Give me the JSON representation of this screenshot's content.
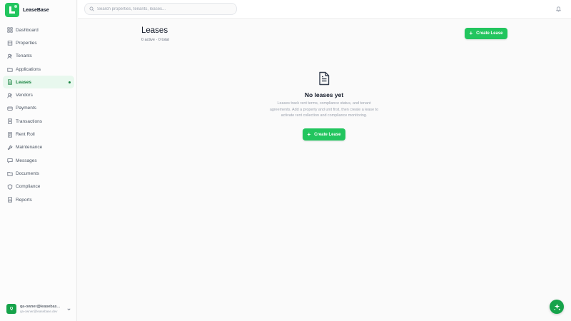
{
  "brand": {
    "name": "LeaseBase"
  },
  "search": {
    "placeholder": "Search properties, tenants, leases..."
  },
  "sidebar": {
    "items": [
      {
        "label": "Dashboard",
        "icon": "grid-icon"
      },
      {
        "label": "Properties",
        "icon": "building-icon"
      },
      {
        "label": "Tenants",
        "icon": "users-icon"
      },
      {
        "label": "Applications",
        "icon": "folder-icon"
      },
      {
        "label": "Leases",
        "icon": "file-icon",
        "active": true
      },
      {
        "label": "Vendors",
        "icon": "users-icon"
      },
      {
        "label": "Payments",
        "icon": "credit-card-icon"
      },
      {
        "label": "Transactions",
        "icon": "list-icon"
      },
      {
        "label": "Rent Roll",
        "icon": "document-icon"
      },
      {
        "label": "Maintenance",
        "icon": "wrench-icon"
      },
      {
        "label": "Messages",
        "icon": "message-icon"
      },
      {
        "label": "Documents",
        "icon": "folder-icon"
      },
      {
        "label": "Compliance",
        "icon": "shield-icon"
      },
      {
        "label": "Reports",
        "icon": "report-icon"
      }
    ]
  },
  "user": {
    "initial": "Q",
    "name": "qa-owner@leasebas...",
    "email": "qa-owner@leasebase.dev"
  },
  "main": {
    "title": "Leases",
    "subtitle": "0 active · 0 total",
    "create_label": "Create Lease",
    "empty": {
      "title": "No leases yet",
      "description": "Leases track rent terms, compliance status, and tenant agreements. Add a property and unit first, then create a lease to activate rent collection and compliance monitoring.",
      "button_label": "Create Lease"
    }
  },
  "colors": {
    "accent": "#22c55e",
    "accent_dark": "#16a34a",
    "active_bg": "#e8f8ee"
  }
}
